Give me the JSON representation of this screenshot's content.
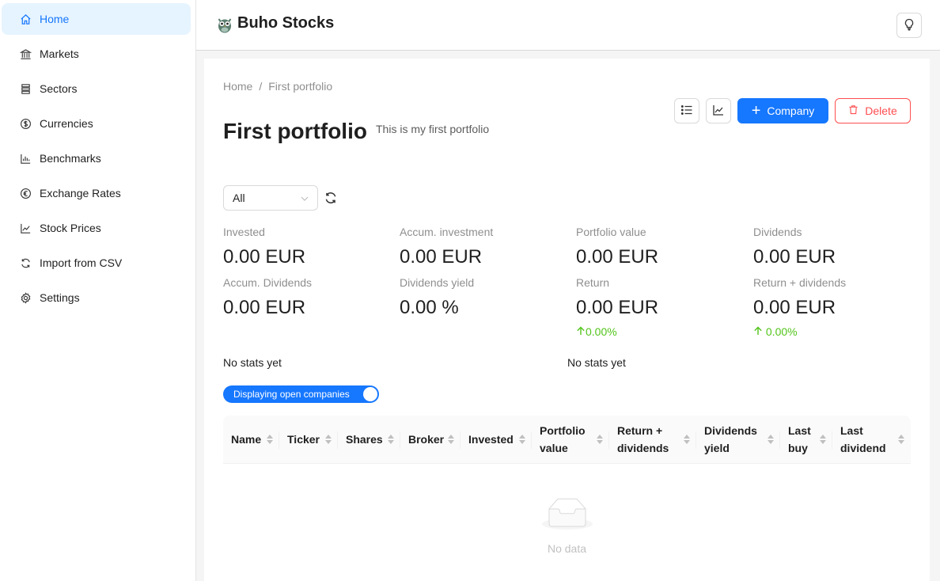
{
  "app": {
    "title": "Buho Stocks"
  },
  "sidebar": {
    "items": [
      {
        "label": "Home",
        "icon": "home-icon",
        "active": true
      },
      {
        "label": "Markets",
        "icon": "bank-icon"
      },
      {
        "label": "Sectors",
        "icon": "sectors-icon"
      },
      {
        "label": "Currencies",
        "icon": "dollar-icon"
      },
      {
        "label": "Benchmarks",
        "icon": "bar-chart-icon"
      },
      {
        "label": "Exchange Rates",
        "icon": "euro-icon"
      },
      {
        "label": "Stock Prices",
        "icon": "line-chart-icon"
      },
      {
        "label": "Import from CSV",
        "icon": "sync-icon"
      },
      {
        "label": "Settings",
        "icon": "gear-icon"
      }
    ]
  },
  "breadcrumb": {
    "home": "Home",
    "separator": "/",
    "current": "First portfolio"
  },
  "portfolio": {
    "title": "First portfolio",
    "description": "This is my first portfolio"
  },
  "actions": {
    "company_label": "Company",
    "delete_label": "Delete"
  },
  "filter": {
    "selected": "All"
  },
  "stats": {
    "invested": {
      "label": "Invested",
      "value": "0.00 EUR"
    },
    "accum_investment": {
      "label": "Accum. investment",
      "value": "0.00 EUR"
    },
    "portfolio_value": {
      "label": "Portfolio value",
      "value": "0.00 EUR"
    },
    "dividends": {
      "label": "Dividends",
      "value": "0.00 EUR"
    },
    "accum_dividends": {
      "label": "Accum. Dividends",
      "value": "0.00 EUR"
    },
    "dividends_yield": {
      "label": "Dividends yield",
      "value": "0.00 %"
    },
    "return": {
      "label": "Return",
      "value": "0.00 EUR",
      "change": "0.00%"
    },
    "return_dividends": {
      "label": "Return + dividends",
      "value": "0.00 EUR",
      "change": " 0.00%"
    }
  },
  "no_stats": {
    "left": "No stats yet",
    "right": "No stats yet"
  },
  "toggle": {
    "label": "Displaying open companies",
    "on": true
  },
  "table": {
    "columns": [
      "Name",
      "Ticker",
      "Shares",
      "Broker",
      "Invested",
      "Portfolio value",
      "Return + dividends",
      "Dividends yield",
      "Last buy",
      "Last dividend"
    ],
    "rows": [],
    "empty_text": "No data"
  },
  "colors": {
    "primary": "#1677ff",
    "danger": "#ff4d4f",
    "success": "#52c41a",
    "active_bg": "#e6f4ff"
  }
}
